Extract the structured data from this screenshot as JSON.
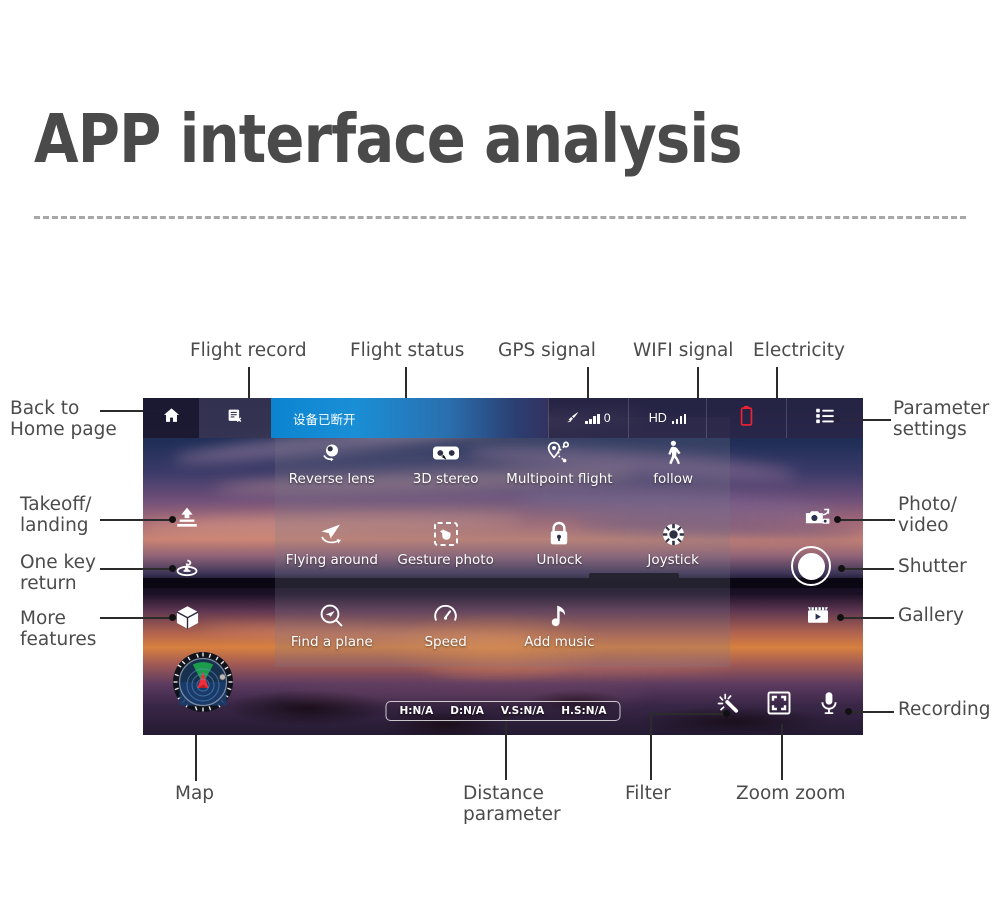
{
  "page": {
    "title": "APP interface analysis"
  },
  "device": {
    "topbar": {
      "home_icon": "home-icon",
      "flight_record_icon": "flight-record-icon",
      "status_text": "设备已断开",
      "gps_icon": "gps-satellite-icon",
      "gps_count": "0",
      "wifi_label": "HD",
      "wifi_icon": "signal-bars-icon",
      "battery_icon": "battery-icon",
      "battery_color": "#ee2233",
      "settings_icon": "list-settings-icon"
    },
    "left_controls": [
      {
        "name": "takeoff-landing",
        "icon": "takeoff-landing-icon"
      },
      {
        "name": "one-key-return",
        "icon": "one-key-return-icon"
      },
      {
        "name": "more-features",
        "icon": "cube-icon"
      }
    ],
    "right_controls": [
      {
        "name": "photo-video-toggle",
        "icon": "camera-switch-icon"
      },
      {
        "name": "shutter",
        "icon": "shutter-circle-icon"
      },
      {
        "name": "gallery",
        "icon": "film-play-icon"
      }
    ],
    "menu_items": [
      {
        "label": "Reverse lens",
        "icon": "reverse-lens-icon"
      },
      {
        "label": "3D stereo",
        "icon": "vr-goggles-icon"
      },
      {
        "label": "Multipoint flight",
        "icon": "waypoint-route-icon"
      },
      {
        "label": "follow",
        "icon": "walking-person-icon"
      },
      {
        "label": "Flying around",
        "icon": "orbit-plane-icon"
      },
      {
        "label": "Gesture photo",
        "icon": "gesture-frame-icon"
      },
      {
        "label": "Unlock",
        "icon": "lock-icon"
      },
      {
        "label": "Joystick",
        "icon": "joystick-icon"
      },
      {
        "label": "Find a plane",
        "icon": "find-plane-magnifier-icon"
      },
      {
        "label": "Speed",
        "icon": "speedometer-icon"
      },
      {
        "label": "Add music",
        "icon": "music-note-icon"
      }
    ],
    "distance_parameters": [
      "H:N/A",
      "D:N/A",
      "V.S:N/A",
      "H.S:N/A"
    ],
    "bottom_controls": [
      {
        "name": "filter",
        "icon": "magic-wand-icon"
      },
      {
        "name": "zoom",
        "icon": "zoom-frame-icon"
      },
      {
        "name": "recording",
        "icon": "microphone-icon"
      }
    ],
    "map_widget": {
      "name": "compass-radar",
      "icon": "compass-radar-icon"
    }
  },
  "annotations": {
    "back_to_home": "Back to\nHome page",
    "flight_record": "Flight record",
    "flight_status": "Flight status",
    "gps_signal": "GPS signal",
    "wifi_signal": "WIFI signal",
    "electricity": "Electricity",
    "parameter_settings": "Parameter\nsettings",
    "takeoff_landing": "Takeoff/\nlanding",
    "one_key_return": "One key\nreturn",
    "more_features": "More\nfeatures",
    "photo_video": "Photo/\nvideo",
    "shutter": "Shutter",
    "gallery": "Gallery",
    "recording": "Recording",
    "map": "Map",
    "distance_parameter": "Distance\nparameter",
    "filter": "Filter",
    "zoom_zoom": "Zoom zoom"
  }
}
